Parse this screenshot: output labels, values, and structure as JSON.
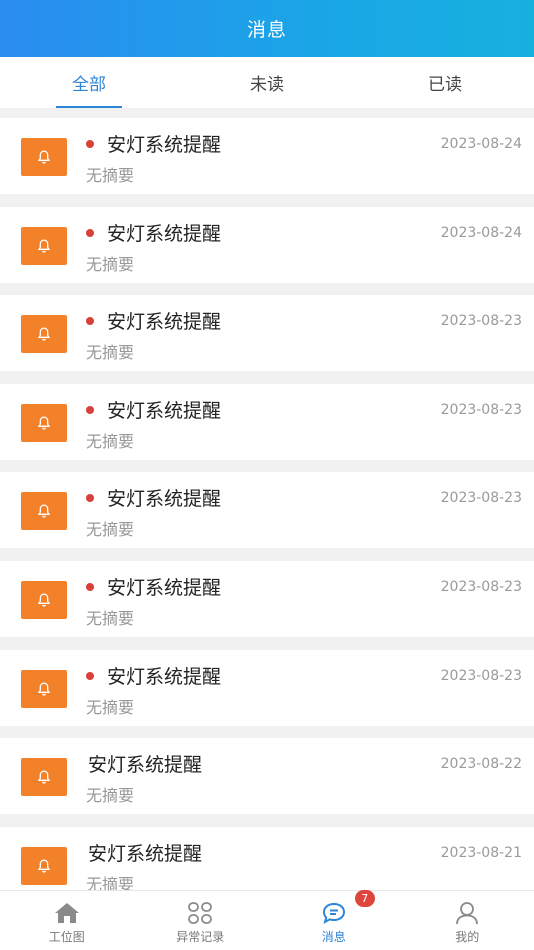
{
  "header": {
    "title": "消息"
  },
  "tabs": [
    {
      "label": "全部",
      "active": true
    },
    {
      "label": "未读",
      "active": false
    },
    {
      "label": "已读",
      "active": false
    }
  ],
  "messages": [
    {
      "title": "安灯系统提醒",
      "summary": "无摘要",
      "date": "2023-08-24",
      "unread": true
    },
    {
      "title": "安灯系统提醒",
      "summary": "无摘要",
      "date": "2023-08-24",
      "unread": true
    },
    {
      "title": "安灯系统提醒",
      "summary": "无摘要",
      "date": "2023-08-23",
      "unread": true
    },
    {
      "title": "安灯系统提醒",
      "summary": "无摘要",
      "date": "2023-08-23",
      "unread": true
    },
    {
      "title": "安灯系统提醒",
      "summary": "无摘要",
      "date": "2023-08-23",
      "unread": true
    },
    {
      "title": "安灯系统提醒",
      "summary": "无摘要",
      "date": "2023-08-23",
      "unread": true
    },
    {
      "title": "安灯系统提醒",
      "summary": "无摘要",
      "date": "2023-08-23",
      "unread": true
    },
    {
      "title": "安灯系统提醒",
      "summary": "无摘要",
      "date": "2023-08-22",
      "unread": false
    },
    {
      "title": "安灯系统提醒",
      "summary": "无摘要",
      "date": "2023-08-21",
      "unread": false
    }
  ],
  "message_icon": "bell-icon",
  "bottom_nav": [
    {
      "label": "工位图",
      "icon": "home-icon",
      "active": false
    },
    {
      "label": "异常记录",
      "icon": "grid-icon",
      "active": false
    },
    {
      "label": "消息",
      "icon": "chat-icon",
      "active": true,
      "badge": "7"
    },
    {
      "label": "我的",
      "icon": "user-icon",
      "active": false
    }
  ],
  "colors": {
    "accent": "#2e86d8",
    "header_start": "#2a8cf0",
    "header_end": "#17b1de",
    "icon_bg": "#f28129",
    "unread_dot": "#d9403a"
  }
}
